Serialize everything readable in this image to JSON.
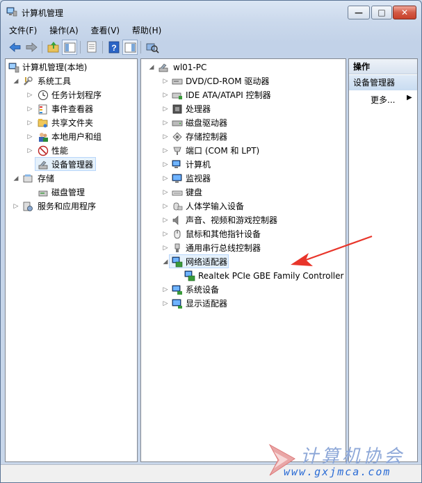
{
  "window": {
    "title": "计算机管理"
  },
  "menu": [
    "文件(F)",
    "操作(A)",
    "查看(V)",
    "帮助(H)"
  ],
  "toolbar": [
    "back-icon",
    "forward-icon",
    "up-folder-icon",
    "show-tree-icon",
    "export-icon",
    "help-icon",
    "console-icon",
    "scan-hardware-icon"
  ],
  "left_tree": {
    "root": "计算机管理(本地)",
    "items": [
      {
        "label": "系统工具",
        "level": 1,
        "expander": "open",
        "icon": "tools-icon"
      },
      {
        "label": "任务计划程序",
        "level": 2,
        "expander": "closed",
        "icon": "clock-icon"
      },
      {
        "label": "事件查看器",
        "level": 2,
        "expander": "closed",
        "icon": "event-viewer-icon"
      },
      {
        "label": "共享文件夹",
        "level": 2,
        "expander": "closed",
        "icon": "shared-folder-icon"
      },
      {
        "label": "本地用户和组",
        "level": 2,
        "expander": "closed",
        "icon": "users-icon"
      },
      {
        "label": "性能",
        "level": 2,
        "expander": "closed",
        "icon": "performance-icon"
      },
      {
        "label": "设备管理器",
        "level": 2,
        "expander": "none",
        "icon": "device-manager-icon",
        "selected": true
      },
      {
        "label": "存储",
        "level": 1,
        "expander": "open",
        "icon": "storage-icon"
      },
      {
        "label": "磁盘管理",
        "level": 2,
        "expander": "none",
        "icon": "disk-icon"
      },
      {
        "label": "服务和应用程序",
        "level": 1,
        "expander": "closed",
        "icon": "services-icon"
      }
    ]
  },
  "device_tree": {
    "root": "wl01-PC",
    "items": [
      {
        "label": "DVD/CD-ROM 驱动器",
        "level": 1,
        "expander": "closed",
        "icon": "dvd-icon"
      },
      {
        "label": "IDE ATA/ATAPI 控制器",
        "level": 1,
        "expander": "closed",
        "icon": "ide-controller-icon"
      },
      {
        "label": "处理器",
        "level": 1,
        "expander": "closed",
        "icon": "processor-icon"
      },
      {
        "label": "磁盘驱动器",
        "level": 1,
        "expander": "closed",
        "icon": "disk-drive-icon"
      },
      {
        "label": "存储控制器",
        "level": 1,
        "expander": "closed",
        "icon": "storage-controller-icon"
      },
      {
        "label": "端口 (COM 和 LPT)",
        "level": 1,
        "expander": "closed",
        "icon": "port-icon"
      },
      {
        "label": "计算机",
        "level": 1,
        "expander": "closed",
        "icon": "computer-icon"
      },
      {
        "label": "监视器",
        "level": 1,
        "expander": "closed",
        "icon": "monitor-icon"
      },
      {
        "label": "键盘",
        "level": 1,
        "expander": "closed",
        "icon": "keyboard-icon"
      },
      {
        "label": "人体学输入设备",
        "level": 1,
        "expander": "closed",
        "icon": "hid-icon"
      },
      {
        "label": "声音、视频和游戏控制器",
        "level": 1,
        "expander": "closed",
        "icon": "sound-icon"
      },
      {
        "label": "鼠标和其他指针设备",
        "level": 1,
        "expander": "closed",
        "icon": "mouse-icon"
      },
      {
        "label": "通用串行总线控制器",
        "level": 1,
        "expander": "closed",
        "icon": "usb-icon"
      },
      {
        "label": "网络适配器",
        "level": 1,
        "expander": "open",
        "icon": "network-adapter-icon",
        "selected": true
      },
      {
        "label": "Realtek PCIe GBE Family Controller",
        "level": 2,
        "expander": "none",
        "icon": "network-card-icon"
      },
      {
        "label": "系统设备",
        "level": 1,
        "expander": "closed",
        "icon": "system-devices-icon"
      },
      {
        "label": "显示适配器",
        "level": 1,
        "expander": "closed",
        "icon": "display-adapter-icon"
      }
    ]
  },
  "actions": {
    "header": "操作",
    "selected": "设备管理器",
    "more": "更多..."
  },
  "watermark": {
    "text": "计算机协会",
    "url": "www.gxjmca.com"
  }
}
